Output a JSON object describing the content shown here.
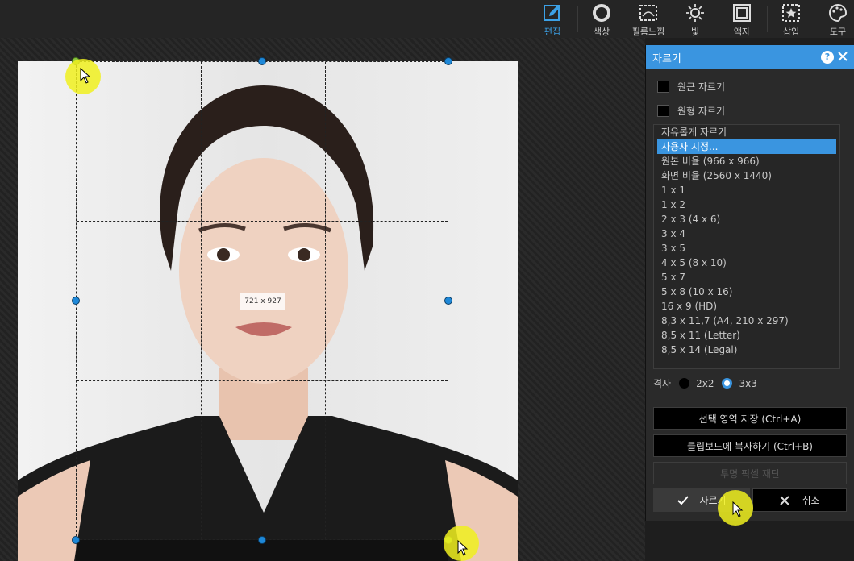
{
  "toolbar": {
    "tools": [
      {
        "label": "편집",
        "icon": "edit-icon",
        "active": true
      },
      {
        "label": "색상",
        "icon": "color-circle-icon"
      },
      {
        "label": "필름느낌",
        "icon": "film-icon"
      },
      {
        "label": "빛",
        "icon": "sun-icon"
      },
      {
        "label": "액자",
        "icon": "frame-icon"
      },
      {
        "label": "삽입",
        "icon": "insert-star-icon"
      },
      {
        "label": "도구",
        "icon": "palette-icon"
      }
    ],
    "accent": "#3ca1e6"
  },
  "canvas": {
    "selection_size_label": "721 x 927"
  },
  "panel": {
    "title": "자르기",
    "help": "?",
    "checkboxes": [
      {
        "label": "원근 자르기",
        "checked": false
      },
      {
        "label": "원형 자르기",
        "checked": false
      }
    ],
    "ratios": [
      "자유롭게 자르기",
      "사용자 지정...",
      "원본 비율 (966 x 966)",
      "화면 비율 (2560 x 1440)",
      "1 x 1",
      "1 x 2",
      "2 x 3 (4 x 6)",
      "3 x 4",
      "3 x 5",
      "4 x 5 (8 x 10)",
      "5 x 7",
      "5 x 8 (10 x 16)",
      "16 x 9 (HD)",
      "8,3 x 11,7 (A4, 210 x 297)",
      "8,5 x 11 (Letter)",
      "8,5 x 14 (Legal)"
    ],
    "selected_ratio": "사용자 지정...",
    "grid": {
      "label": "격자",
      "option_2x2": "2x2",
      "option_3x3": "3x3",
      "selected": "3x3"
    },
    "buttons": {
      "save_selection": "선택 영역 저장 (Ctrl+A)",
      "copy_clipboard": "클립보드에 복사하기 (Ctrl+B)",
      "trim_transparent": "투명 픽셀 재단",
      "crop": "자르기",
      "cancel": "취소"
    },
    "accent": "#3a95e0"
  }
}
